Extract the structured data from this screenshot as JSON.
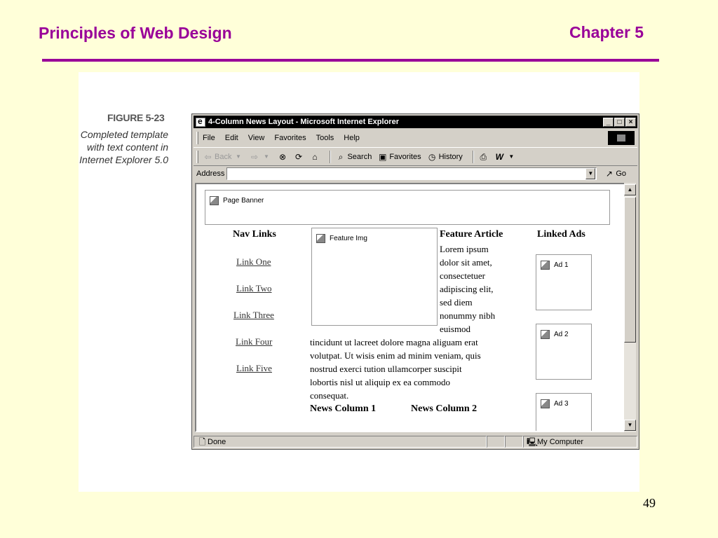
{
  "slide": {
    "title": "Principles of Web Design",
    "chapter": "Chapter 5",
    "page_number": "49",
    "accent_color": "#990099"
  },
  "figure": {
    "label": "FIGURE 5-23",
    "caption_lines": [
      "Completed template",
      "with text content in",
      "Internet Explorer 5.0"
    ]
  },
  "browser": {
    "title": "4-Column News Layout - Microsoft Internet Explorer",
    "window_buttons": [
      "_",
      "□",
      "×"
    ],
    "menu": [
      "File",
      "Edit",
      "View",
      "Favorites",
      "Tools",
      "Help"
    ],
    "toolbar": {
      "back": "Back",
      "search": "Search",
      "favorites": "Favorites",
      "history": "History"
    },
    "address_label": "Address",
    "address_value": "",
    "go_label": "Go",
    "status_text": "Done",
    "zone_text": "My Computer"
  },
  "page": {
    "banner_label": "Page Banner",
    "nav_heading": "Nav Links",
    "nav_links": [
      "Link One",
      "Link Two",
      "Link Three",
      "Link Four",
      "Link Five"
    ],
    "feature_img_label": "Feature Img",
    "feature_heading": "Feature Article",
    "feature_narrow_lines": [
      "Lorem ipsum",
      "dolor sit amet,",
      "consectetuer",
      "adipiscing elit,",
      "sed diem",
      "nonummy nibh",
      "euismod"
    ],
    "feature_wide_lines": [
      "tincidunt ut lacreet dolore magna aliguam erat",
      "volutpat. Ut wisis enim ad minim veniam, quis",
      "nostrud exerci tution ullamcorper suscipit",
      "lobortis nisl ut aliquip ex ea commodo",
      "consequat."
    ],
    "ads_heading": "Linked Ads",
    "ads": [
      "Ad 1",
      "Ad 2",
      "Ad 3"
    ],
    "news_columns": [
      "News Column 1",
      "News Column 2"
    ]
  }
}
